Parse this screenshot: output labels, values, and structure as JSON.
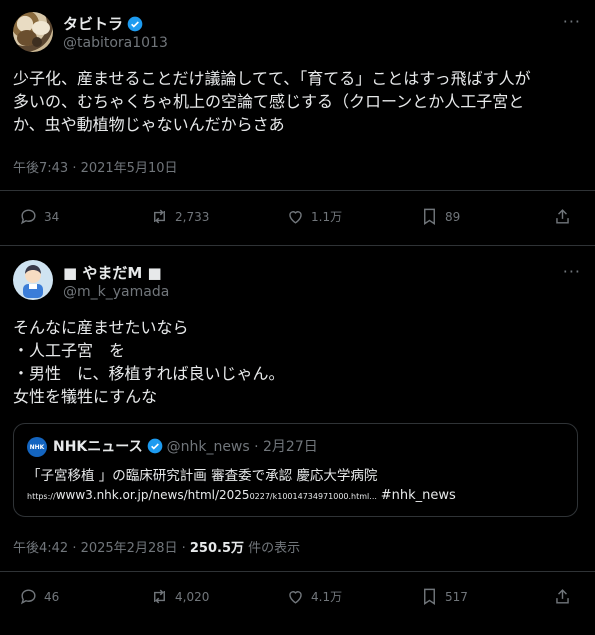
{
  "tweet1": {
    "display_name": "タビトラ",
    "handle": "@tabitora1013",
    "text": "少子化、産ませることだけ議論してて、「育てる」ことはすっ飛ばす人が\n多いの、むちゃくちゃ机上の空論て感じする（クローンとか人工子宮と\nか、虫や動植物じゃないんだからさあ",
    "timestamp": "午後7:43 · 2021年5月10日",
    "replies": "34",
    "reposts": "2,733",
    "likes": "1.1万",
    "bookmarks": "89",
    "more_label": "···"
  },
  "tweet2": {
    "display_name": "■ やまだM ■",
    "handle": "@m_k_yamada",
    "text": "そんなに産ませたいなら\n・人工子宮　を\n・男性　に、移植すれば良いじゃん。\n女性を犠牲にすんな",
    "timestamp": "午後4:42 · 2025年2月28日 · ",
    "views_count": "250.5万",
    "views_label": " 件の表示",
    "replies": "46",
    "reposts": "4,020",
    "likes": "4.1万",
    "bookmarks": "517",
    "more_label": "···",
    "quote": {
      "logo_text": "NHK",
      "name": "NHKニュース",
      "handle": "@nhk_news · 2月27日",
      "headline": "「子宮移植 」の臨床研究計画 審査委で承認 慶応大学病院",
      "url_prefix": "https://",
      "url_main": "www3.nhk.or.jp/news/html/2025",
      "url_small": "0227/k10014734971000.html...",
      "hashtag": "#nhk_news"
    }
  },
  "icons": [
    "reply-icon",
    "repost-icon",
    "like-icon",
    "bookmark-icon",
    "share-icon",
    "verified-badge-icon"
  ],
  "colors": {
    "background": "#000000",
    "text": "#e7e9ea",
    "muted": "#71767b",
    "verified": "#1d9bf0",
    "divider": "#2f3336"
  }
}
